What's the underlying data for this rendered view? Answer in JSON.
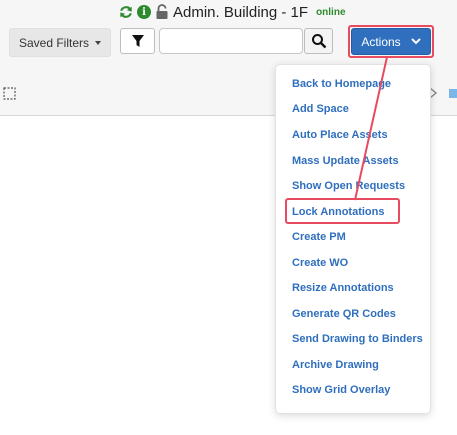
{
  "header": {
    "building": "Admin. Building - 1F",
    "status": "online"
  },
  "toolbar": {
    "saved_filters_label": "Saved Filters",
    "search_placeholder": "",
    "actions_label": "Actions"
  },
  "actions_menu": {
    "items": [
      "Back to Homepage",
      "Add Space",
      "Auto Place Assets",
      "Mass Update Assets",
      "Show Open Requests",
      "Lock Annotations",
      "Create PM",
      "Create WO",
      "Resize Annotations",
      "Generate QR Codes",
      "Send Drawing to Binders",
      "Archive Drawing",
      "Show Grid Overlay"
    ],
    "highlighted_item": "Lock Annotations"
  },
  "colors": {
    "accent": "#2f6fbe",
    "online": "#2f8a2f",
    "annotation": "#e84a5f"
  },
  "icons": [
    "refresh-icon",
    "info-icon",
    "lock-icon",
    "caret-down-icon",
    "filter-icon",
    "search-icon",
    "chevron-down-icon",
    "selection-icon"
  ]
}
